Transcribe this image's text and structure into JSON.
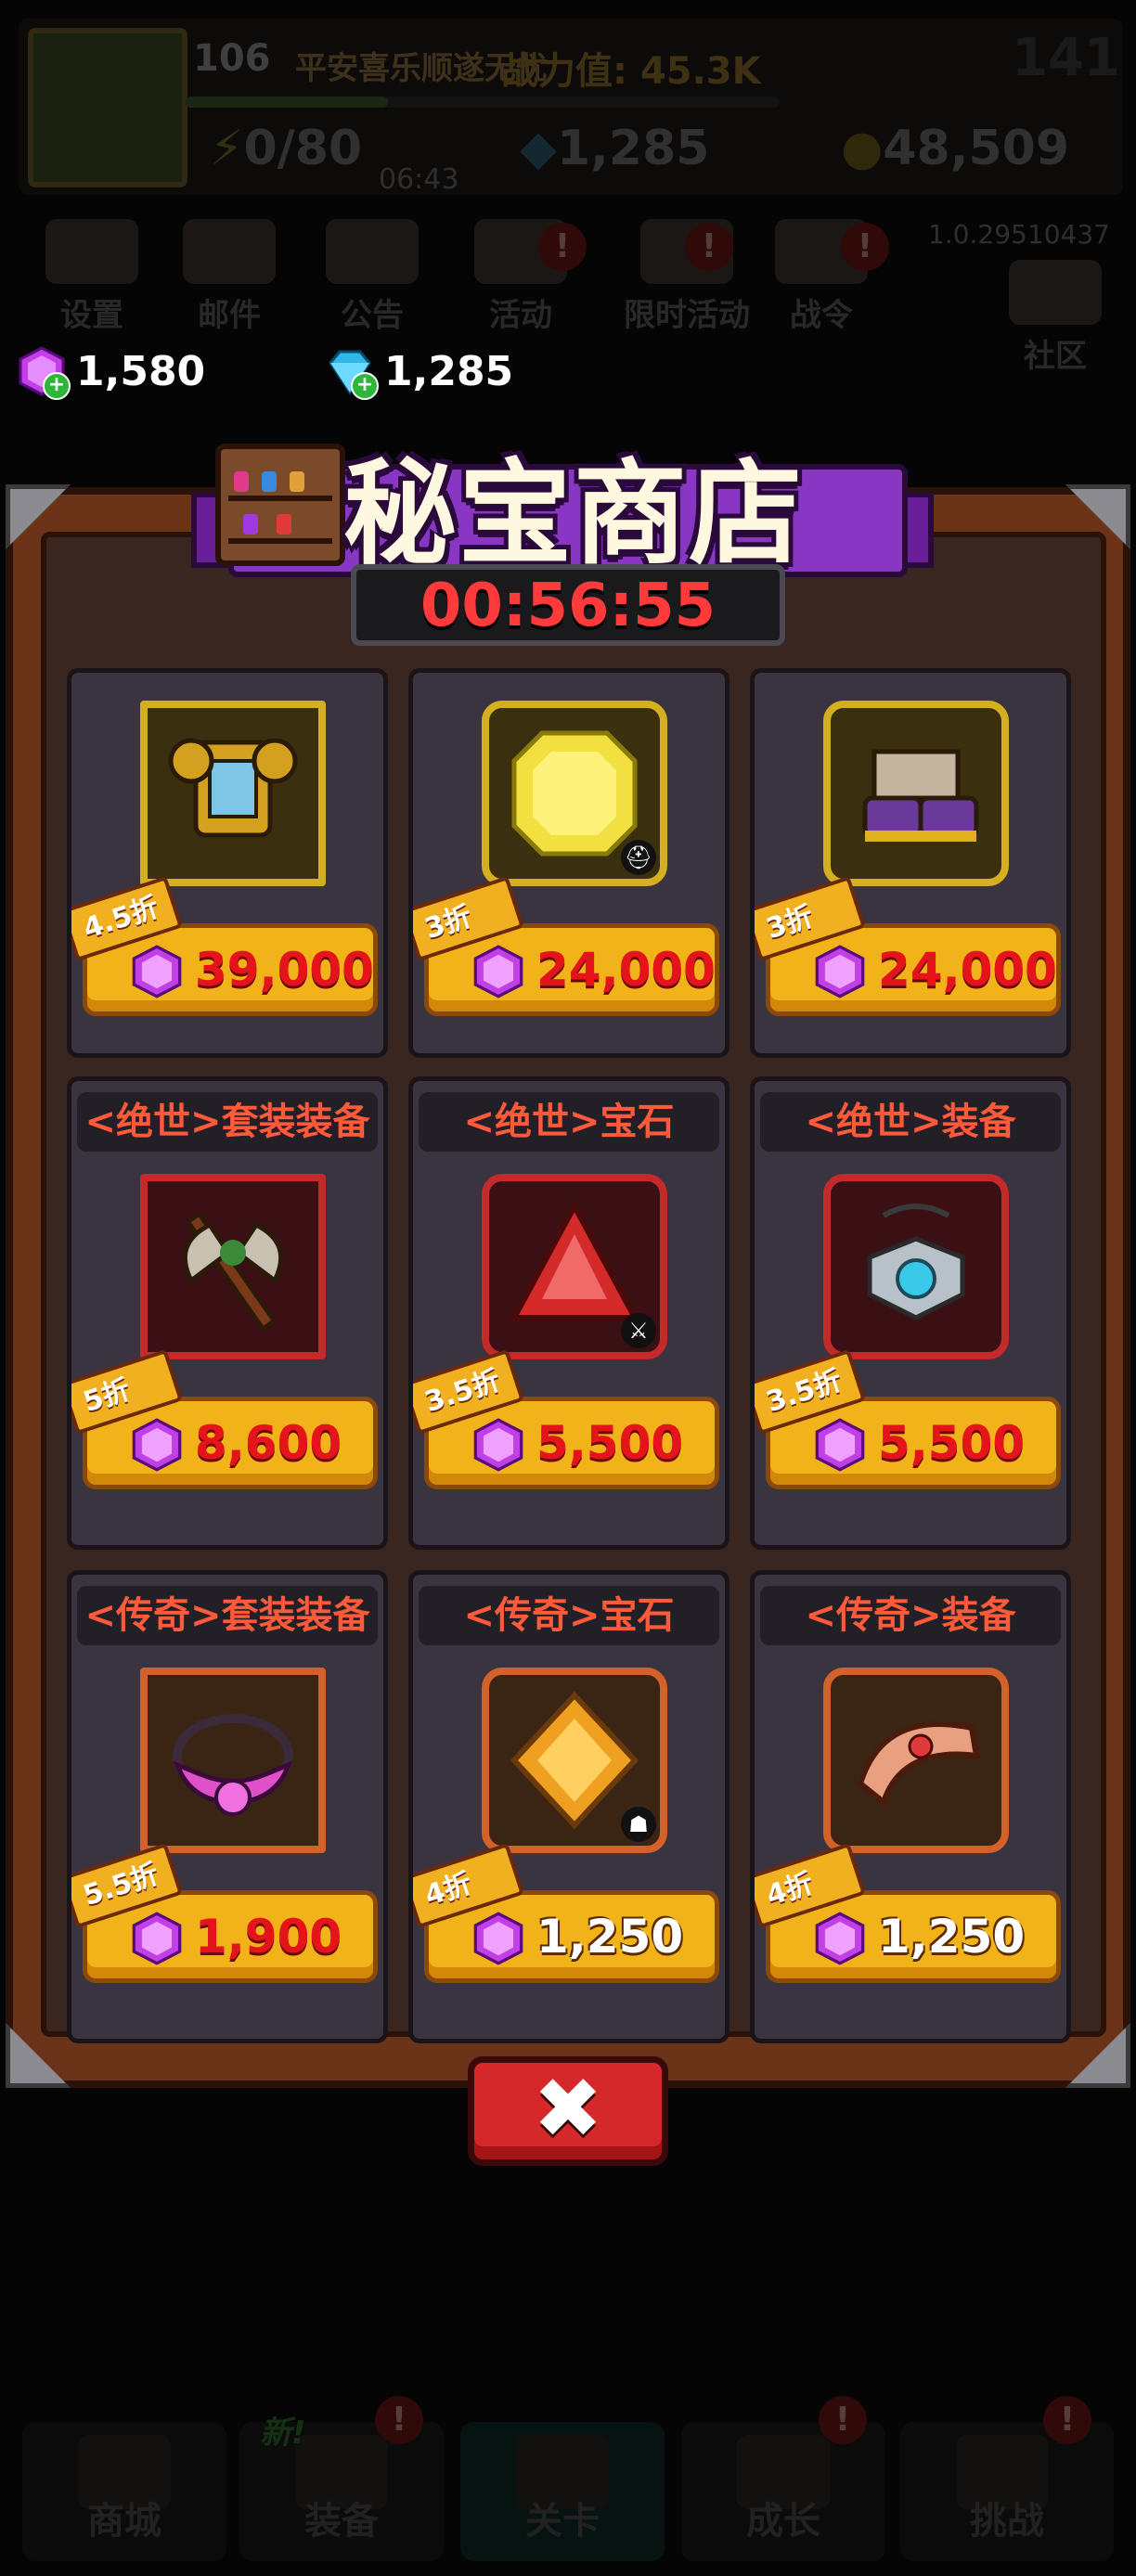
{
  "hud": {
    "level": "106",
    "player_name": "平安喜乐顺遂无忧",
    "power_label": "战力值:",
    "power_value": "45.3K",
    "counter": "141",
    "energy": "0/80",
    "energy_timer": "06:43",
    "diamonds": "1,285",
    "coins": "48,509",
    "version": "1.0.29510437"
  },
  "top_menu": [
    {
      "label": "设置",
      "badge": ""
    },
    {
      "label": "邮件",
      "badge": ""
    },
    {
      "label": "公告",
      "badge": ""
    },
    {
      "label": "活动",
      "badge": "!"
    },
    {
      "label": "限时活动",
      "badge": "!"
    },
    {
      "label": "战令",
      "badge": "!"
    }
  ],
  "social_label": "社区",
  "currency": {
    "purple_gems": "1,580",
    "diamonds": "1,285"
  },
  "shop": {
    "title": "秘宝商店",
    "timer": "00:56:55",
    "items": [
      {
        "name": "",
        "price": "39,000",
        "discount": "4.5折",
        "frame_color": "#d4b020",
        "price_color": "red",
        "icon": "golden-armor-icon"
      },
      {
        "name": "",
        "price": "24,000",
        "discount": "3折",
        "frame_color": "#d4b020",
        "price_color": "red",
        "icon": "yellow-gem-icon"
      },
      {
        "name": "",
        "price": "24,000",
        "discount": "3折",
        "frame_color": "#d4b020",
        "price_color": "red",
        "icon": "golden-boots-icon"
      },
      {
        "name": "<绝世>套装装备",
        "price": "8,600",
        "discount": "5折",
        "frame_color": "#c42a2a",
        "price_color": "red",
        "icon": "battle-axe-icon"
      },
      {
        "name": "<绝世>宝石",
        "price": "5,500",
        "discount": "3.5折",
        "frame_color": "#c42a2a",
        "price_color": "red",
        "icon": "red-gem-icon"
      },
      {
        "name": "<绝世>装备",
        "price": "5,500",
        "discount": "3.5折",
        "frame_color": "#c42a2a",
        "price_color": "red",
        "icon": "amulet-icon"
      },
      {
        "name": "<传奇>套装装备",
        "price": "1,900",
        "discount": "5.5折",
        "frame_color": "#d4602a",
        "price_color": "red",
        "icon": "pink-necklace-icon"
      },
      {
        "name": "<传奇>宝石",
        "price": "1,250",
        "discount": "4折",
        "frame_color": "#d4602a",
        "price_color": "white",
        "icon": "orange-gem-icon"
      },
      {
        "name": "<传奇>装备",
        "price": "1,250",
        "discount": "4折",
        "frame_color": "#d4602a",
        "price_color": "white",
        "icon": "bracelet-icon"
      }
    ]
  },
  "bottom_nav": [
    {
      "label": "商城",
      "badge": ""
    },
    {
      "label": "装备",
      "badge": "!"
    },
    {
      "label": "关卡",
      "badge": ""
    },
    {
      "label": "成长",
      "badge": "!"
    },
    {
      "label": "挑战",
      "badge": "!"
    }
  ],
  "new_tag": "新!"
}
